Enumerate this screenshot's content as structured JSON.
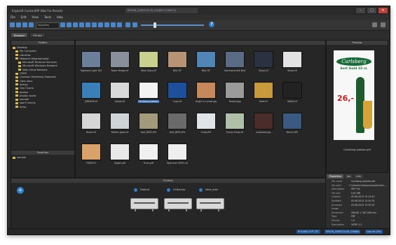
{
  "titlebar": {
    "title": "Ergosoft CarlsonRIP (Not For Resale)",
    "account": "EPSON_SURECOLOR_S30600 (S30670)",
    "minimize": "–",
    "maximize": "□",
    "close": "✕"
  },
  "menu": [
    "File",
    "Edit",
    "View",
    "Tools",
    "Help"
  ],
  "toolbar": {
    "location_select": "Favorites"
  },
  "tabs": [
    "Browser",
    "Printer"
  ],
  "panels": {
    "folders": "Folders",
    "favorites": "Favorites",
    "preview": "Preview",
    "printers": "Printers"
  },
  "folder_tree": [
    "Desktop",
    "My Computer",
    "Libraries",
    "Network Neighborhood",
    "Microsoft Terminal Services",
    "Microsoft Windows Network",
    "Web Client Network",
    "CMYK",
    "Carlsson Marketing Materials",
    "class docs",
    "design",
    "Hex Charts",
    "photos",
    "photos world",
    "sample",
    "sport menus",
    "temp"
  ],
  "favorites": [
    "sample"
  ],
  "thumbnails": [
    {
      "label": "Highland Light 300.jpg",
      "color": "#6b7e9a"
    },
    {
      "label": "Tower Bridge.tif",
      "color": "#8a8f9c"
    },
    {
      "label": "Wine Glass.tif",
      "color": "#c9cf8f"
    },
    {
      "label": "NEA.TIF",
      "color": "#b79376"
    },
    {
      "label": "NEA.TIF",
      "color": "#4f86b6"
    },
    {
      "label": "Hammersmith Bridge.jpg",
      "color": "#5a6b86"
    },
    {
      "label": "Shoes.tif",
      "color": "#2b3140"
    },
    {
      "label": "Sheet.tif",
      "color": "#e3e3e3"
    },
    {
      "label": "JOBDESK.tif",
      "color": "#3a7fb8"
    },
    {
      "label": "Splash.tif",
      "color": "#d9d9d9"
    },
    {
      "label": "Carlsberg plakate.pdf",
      "color": "#f2f2f2"
    },
    {
      "label": "Cups.tif",
      "color": "#1e4f9a"
    },
    {
      "label": "Angle in sunset.jpg",
      "color": "#c7885b"
    },
    {
      "label": "Toaster.jpg",
      "color": "#9b9b9b"
    },
    {
      "label": "Beer.tif",
      "color": "#c99a3b"
    },
    {
      "label": "Kettle.tif",
      "color": "#222222"
    },
    {
      "label": "Books.tif",
      "color": "#d6d6d6"
    },
    {
      "label": "Broken glass.tif",
      "color": "#d0d3d6"
    },
    {
      "label": "AAA_BIRD.JPG",
      "color": "#a39a7c"
    },
    {
      "label": "AAA_BIRD.JPG",
      "color": "#6a6a6a"
    },
    {
      "label": "Snow.JPG",
      "color": "#dfe4e8"
    },
    {
      "label": "Flying things.tif",
      "color": "#b0c0a8"
    },
    {
      "label": "photobox.jpg",
      "color": "#4a2d2a"
    },
    {
      "label": "Beach.JPG",
      "color": "#3b5a82"
    },
    {
      "label": "TIGER.PC",
      "color": "#d9a26a"
    },
    {
      "label": "Spiger.pdf",
      "color": "#e8e8e8"
    },
    {
      "label": "Truck.pdf",
      "color": "#f0f0f0"
    },
    {
      "label": "Spot and CMYK colors.pdf",
      "color": "#eeeeee"
    }
  ],
  "preview": {
    "caption": "Carlsberg plakate.pdf",
    "brand": "Carlsberg",
    "subtitle": "Sort Guld 33 cl.",
    "price": "26,-"
  },
  "prop_tabs": [
    "Properties",
    "Job",
    "Info"
  ],
  "properties": [
    {
      "k": "File name",
      "v": "Carlsberg plakate.pdf"
    },
    {
      "k": "File path",
      "v": "C:\\Users\\Carlsson\\sample\\Carls..."
    },
    {
      "k": "Description",
      "v": "PDF File"
    },
    {
      "k": "File size",
      "v": "0,61 MB"
    },
    {
      "k": "Created",
      "v": "05.06.2015 10:14:42"
    },
    {
      "k": "Modified",
      "v": "05.06.2015 13:30:32"
    },
    {
      "k": "Accessed",
      "v": "05.06.2015 13:30:32"
    },
    {
      "k": "Image",
      "v": ""
    },
    {
      "k": "Dimension",
      "v": "289,80 × 287,508 mm"
    },
    {
      "k": "Type",
      "v": "PDF"
    },
    {
      "k": "Version",
      "v": "1.4"
    },
    {
      "k": "Description",
      "v": "%PDF-1.2"
    }
  ],
  "printers": [
    {
      "label": "Default"
    },
    {
      "label": "Hi-Banner"
    },
    {
      "label": "Next_oder"
    }
  ],
  "status": {
    "left": "ROLAND SOFT JET",
    "mid": "EPSON_SURECOLOR_S30600",
    "right": "Low ink (5%)"
  }
}
